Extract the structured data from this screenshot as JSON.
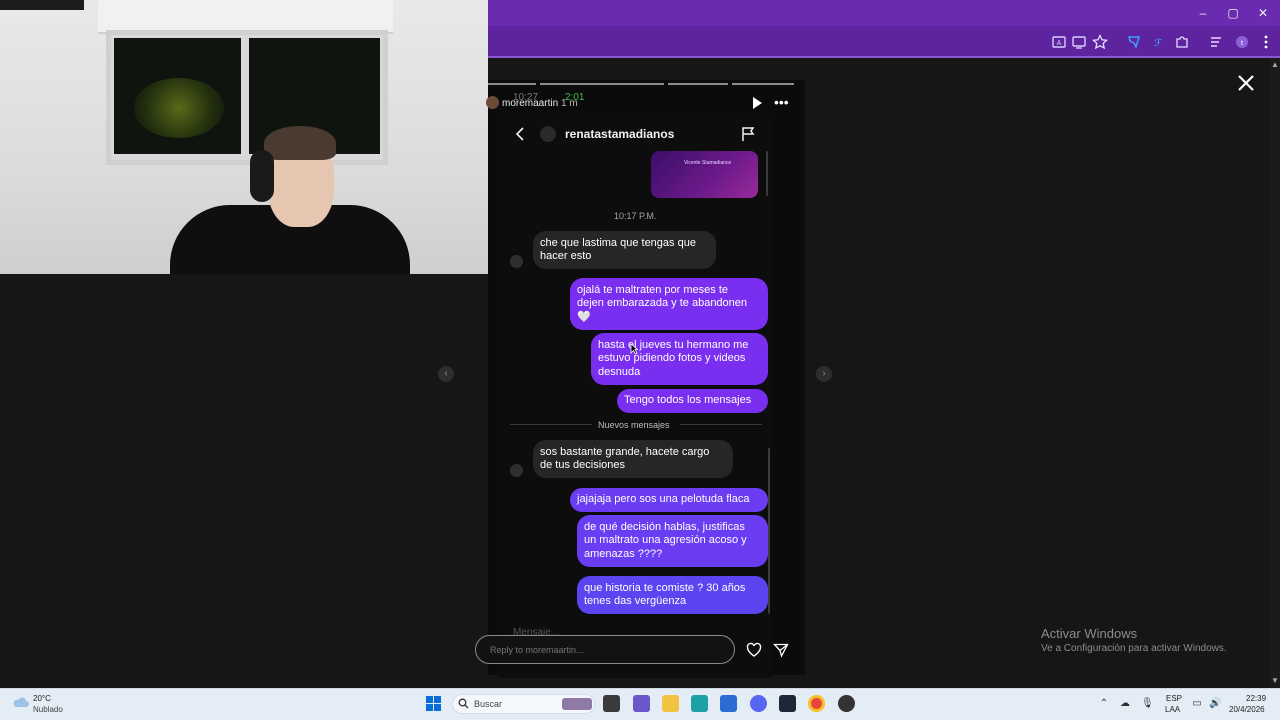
{
  "browser": {
    "window_controls": {
      "minimize": "–",
      "maximize": "▢",
      "close": "✕"
    },
    "toolbar_icons": [
      "translate-icon",
      "cast-icon",
      "star-icon",
      "extension-icon",
      "translate2-icon",
      "puzzle-icon",
      "media-icon",
      "profile-icon",
      "menu-icon"
    ],
    "accent": "#6a2bb0"
  },
  "story": {
    "username": "moremaartin",
    "age": "1 m",
    "status_time": "10:27",
    "status_call": "2:01"
  },
  "dm": {
    "contact": "renatastamadianos",
    "media_caption": "Vicente Stamadianos",
    "timestamp": "10:17 P.M.",
    "new_messages_label": "Nuevos mensajes",
    "input_placeholder": "Mensaje..."
  },
  "messages": [
    {
      "side": "in",
      "lines": [
        "che que lastima que tengas que",
        "hacer esto"
      ]
    },
    {
      "side": "out",
      "lines": [
        "ojalá te maltraten por meses te",
        "dejen embarazada y te abandonen",
        "🤍"
      ]
    },
    {
      "side": "out",
      "lines": [
        "hasta el jueves tu hermano me",
        "estuvo pidiendo fotos y videos",
        "desnuda"
      ]
    },
    {
      "side": "out",
      "lines": [
        "Tengo todos los mensajes"
      ]
    },
    {
      "side": "in",
      "lines": [
        "sos bastante grande, hacete cargo",
        "de tus decisiones"
      ]
    },
    {
      "side": "out",
      "lines": [
        "jajajaja pero sos una pelotuda flaca"
      ]
    },
    {
      "side": "out",
      "lines": [
        "de qué decisión hablas, justificas",
        "un maltrato una agresión acoso y",
        "amenazas ????"
      ]
    },
    {
      "side": "out",
      "lines": [
        "que historia te comiste ? 30 años",
        "tenes das vergüenza"
      ]
    }
  ],
  "reply": {
    "placeholder": "Reply to moremaartin..."
  },
  "watermark": {
    "title": "Activar Windows",
    "subtitle": "Ve a Configuración para activar Windows."
  },
  "taskbar": {
    "weather_temp": "20°C",
    "weather_desc": "Nublado",
    "search_label": "Buscar",
    "lang_top": "ESP",
    "lang_bottom": "LAA",
    "clock_time": "22:39",
    "clock_date": "20/4/2026"
  }
}
